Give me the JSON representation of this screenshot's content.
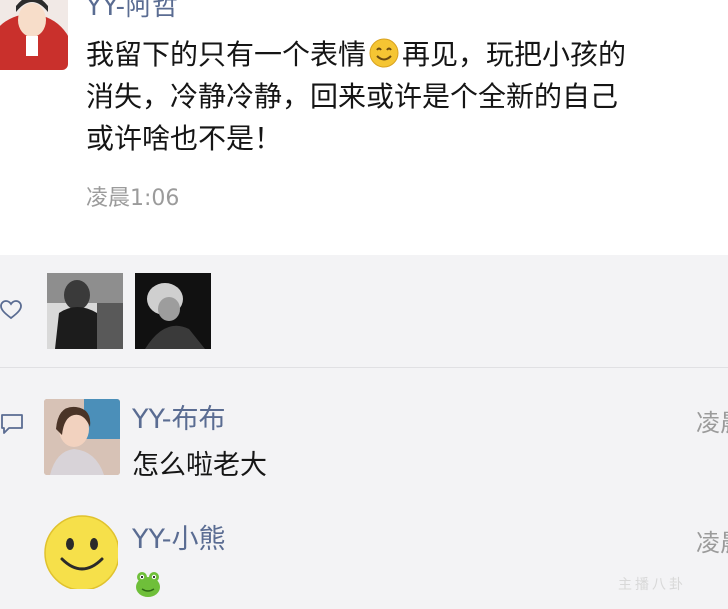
{
  "post": {
    "author": "YY-阿哲",
    "text_lines": [
      {
        "before_emoji": "我留下的只有一个表情",
        "after_emoji": "再见，玩把小孩的"
      },
      "消失，冷静冷静，回来或许是个全新的自己",
      "或许啥也不是！"
    ],
    "inline_emoji": "smile-emoji",
    "time": "凌晨1:06"
  },
  "likes": {
    "icon": "heart-outline-icon",
    "likers": [
      "liker-photo-1",
      "liker-photo-2"
    ]
  },
  "comments": {
    "icon": "comment-bubble-icon",
    "items": [
      {
        "author": "YY-布布",
        "text": "怎么啦老大",
        "time": "凌晨"
      },
      {
        "author": "YY-小熊",
        "sticker": "green-frog-sticker",
        "time": "凌晨"
      }
    ]
  },
  "watermark": "主播八卦",
  "colors": {
    "name_blue": "#5a6c92",
    "text": "#151515",
    "meta_gray": "#9b9b9b",
    "panel_bg": "#f3f3f5"
  }
}
